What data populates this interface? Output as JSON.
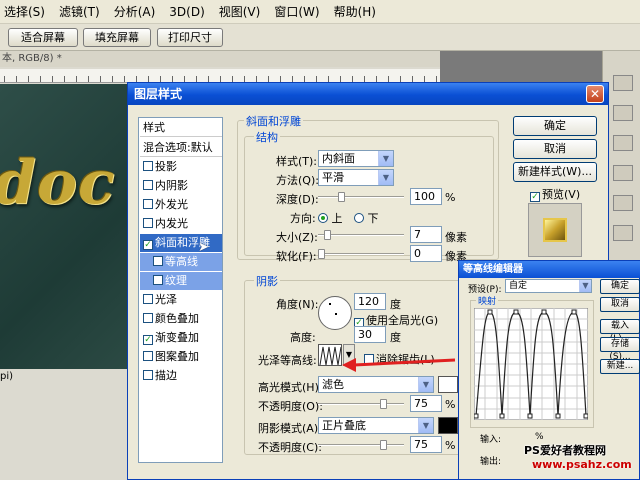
{
  "menubar": {
    "items": [
      "选择(S)",
      "滤镜(T)",
      "分析(A)",
      "3D(D)",
      "视图(V)",
      "窗口(W)",
      "帮助(H)"
    ]
  },
  "options": {
    "fit": "适合屏幕",
    "fill": "填充屏幕",
    "print": "打印尺寸"
  },
  "document": {
    "title": "本, RGB/8) *",
    "text": "doc",
    "status": "pi)"
  },
  "dialog": {
    "title": "图层样式",
    "close": "✕",
    "styles": {
      "header": "样式",
      "blend": "混合选项:默认",
      "items": [
        {
          "label": "投影",
          "checked": false
        },
        {
          "label": "内阴影",
          "checked": false
        },
        {
          "label": "外发光",
          "checked": false
        },
        {
          "label": "内发光",
          "checked": false
        },
        {
          "label": "斜面和浮雕",
          "checked": true
        },
        {
          "label": "等高线",
          "checked": false
        },
        {
          "label": "纹理",
          "checked": false
        },
        {
          "label": "光泽",
          "checked": false
        },
        {
          "label": "颜色叠加",
          "checked": false
        },
        {
          "label": "渐变叠加",
          "checked": true
        },
        {
          "label": "图案叠加",
          "checked": false
        },
        {
          "label": "描边",
          "checked": false
        }
      ]
    },
    "bevel": {
      "group": "斜面和浮雕",
      "structure": "结构",
      "style_label": "样式(T):",
      "style_value": "内斜面",
      "method_label": "方法(Q):",
      "method_value": "平滑",
      "depth_label": "深度(D):",
      "depth_value": "100",
      "depth_unit": "%",
      "direction_label": "方向:",
      "up": "上",
      "down": "下",
      "size_label": "大小(Z):",
      "size_value": "7",
      "size_unit": "像素",
      "soften_label": "软化(F):",
      "soften_value": "0",
      "soften_unit": "像素"
    },
    "shading": {
      "group": "阴影",
      "angle_label": "角度(N):",
      "angle_value": "120",
      "angle_unit": "度",
      "global_light": "使用全局光(G)",
      "altitude_label": "高度:",
      "altitude_value": "30",
      "altitude_unit": "度",
      "gloss_label": "光泽等高线:",
      "antialias": "消除锯齿(L)",
      "hl_mode_label": "高光模式(H):",
      "hl_mode_value": "滤色",
      "hl_opacity_label": "不透明度(O):",
      "hl_opacity_value": "75",
      "shadow_mode_label": "阴影模式(A):",
      "shadow_mode_value": "正片叠底",
      "sh_opacity_label": "不透明度(C):",
      "sh_opacity_value": "75",
      "pct": "%"
    },
    "buttons": {
      "ok": "确定",
      "cancel": "取消",
      "new_style": "新建样式(W)...",
      "preview": "预览(V)"
    }
  },
  "contour_editor": {
    "title": "等高线编辑器",
    "preset_label": "预设(P):",
    "preset_value": "自定",
    "mapping": "映射",
    "input": "输入:",
    "output": "输出:",
    "pct": "%",
    "ok": "确定",
    "cancel": "取消",
    "load": "载入(L)...",
    "save": "存储(S)...",
    "new": "新建..."
  },
  "watermark": {
    "line1": "PS爱好者教程网",
    "line2": "www.psahz.com"
  },
  "colors": {
    "title_blue": "#0a4fd4",
    "selection": "#316ac5",
    "arrow": "#e02020"
  }
}
